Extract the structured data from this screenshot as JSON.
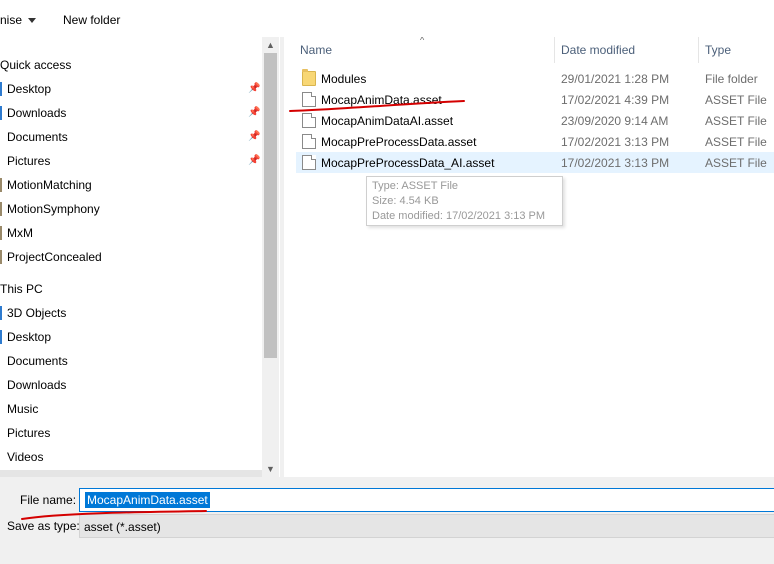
{
  "toolbar": {
    "organise_label": "nise",
    "new_folder_label": "New folder"
  },
  "nav": {
    "quick_access_label": "Quick access",
    "quick_items": [
      {
        "label": "Desktop",
        "pinned": true,
        "mark": "blue"
      },
      {
        "label": "Downloads",
        "pinned": true,
        "mark": "blue"
      },
      {
        "label": "Documents",
        "pinned": true,
        "mark": "none"
      },
      {
        "label": "Pictures",
        "pinned": true,
        "mark": "none"
      },
      {
        "label": "MotionMatching",
        "pinned": false,
        "mark": "gray"
      },
      {
        "label": "MotionSymphony",
        "pinned": false,
        "mark": "gray"
      },
      {
        "label": "MxM",
        "pinned": false,
        "mark": "gray"
      },
      {
        "label": "ProjectConcealed",
        "pinned": false,
        "mark": "gray"
      }
    ],
    "this_pc_label": "This PC",
    "pc_items": [
      {
        "label": "3D Objects",
        "mark": "blue"
      },
      {
        "label": "Desktop",
        "mark": "blue"
      },
      {
        "label": "Documents",
        "mark": "none"
      },
      {
        "label": "Downloads",
        "mark": "none"
      },
      {
        "label": "Music",
        "mark": "none"
      },
      {
        "label": "Pictures",
        "mark": "none"
      },
      {
        "label": "Videos",
        "mark": "none"
      }
    ]
  },
  "list": {
    "columns": {
      "name": "Name",
      "date_modified": "Date modified",
      "type": "Type"
    },
    "rows": [
      {
        "name": "Modules",
        "date": "29/01/2021 1:28 PM",
        "type": "File folder",
        "kind": "folder"
      },
      {
        "name": "MocapAnimData.asset",
        "date": "17/02/2021 4:39 PM",
        "type": "ASSET File",
        "kind": "file"
      },
      {
        "name": "MocapAnimDataAI.asset",
        "date": "23/09/2020 9:14 AM",
        "type": "ASSET File",
        "kind": "file"
      },
      {
        "name": "MocapPreProcessData.asset",
        "date": "17/02/2021 3:13 PM",
        "type": "ASSET File",
        "kind": "file"
      },
      {
        "name": "MocapPreProcessData_AI.asset",
        "date": "17/02/2021 3:13 PM",
        "type": "ASSET File",
        "kind": "file"
      }
    ]
  },
  "tooltip": {
    "type_line": "Type: ASSET File",
    "size_line": "Size: 4.54 KB",
    "date_line": "Date modified: 17/02/2021 3:13 PM"
  },
  "footer": {
    "file_name_label": "File name:",
    "file_name_value": "MocapAnimData.asset",
    "save_as_type_label": "Save as type:",
    "save_as_type_value": "asset (*.asset)"
  },
  "colors": {
    "accent": "#0078d7",
    "annotation_red": "#d40000",
    "hover_row": "#e5f3ff"
  }
}
